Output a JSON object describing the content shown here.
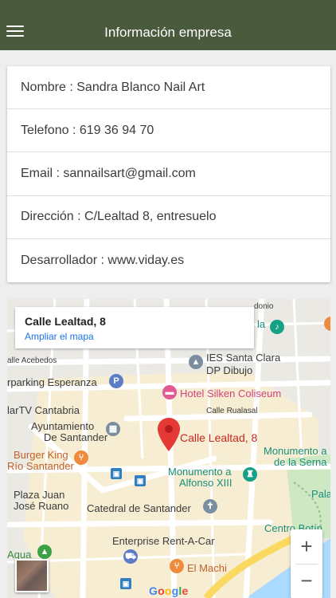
{
  "header": {
    "title": "Información empresa",
    "menu_icon": "hamburger-icon"
  },
  "company": {
    "rows": [
      {
        "label": "Nombre",
        "value": "Sandra Blanco Nail Art"
      },
      {
        "label": "Telefono",
        "value": "619 36 94 70"
      },
      {
        "label": "Email",
        "value": "sannailsart@gmail.com"
      },
      {
        "label": "Dirección",
        "value": "C/Lealtad 8, entresuelo"
      },
      {
        "label": "Desarrollador",
        "value": "www.viday.es"
      }
    ],
    "separator": " : "
  },
  "map": {
    "card_title": "Calle Lealtad, 8",
    "card_link": "Ampliar el mapa",
    "marker_label": "Calle Lealtad, 8",
    "zoom_in": "+",
    "zoom_out": "−",
    "google": [
      "G",
      "o",
      "o",
      "g",
      "l",
      "e"
    ],
    "google_colors": [
      "#4285F4",
      "#EA4335",
      "#FBBC05",
      "#4285F4",
      "#34A853",
      "#EA4335"
    ],
    "labels": {
      "donio": "donio",
      "la": "la",
      "acebedos": "alle Acebedos",
      "ies_santa_clara": "IES Santa Clara",
      "dp_dibujo": "DP Dibujo",
      "parking_esperanza": "rparking Esperanza",
      "hotel_silken": "Hotel Silken Coliseum",
      "lartv": "larTV Cantabria",
      "calle_rualasal": "Calle Rualasal",
      "ayuntamiento_1": "Ayuntamiento",
      "ayuntamiento_2": "De Santander",
      "burger_king": "Burger King",
      "rio_santander": "Río Santander",
      "monumento_serna_1": "Monumento a",
      "monumento_serna_2": "de la Serna",
      "monumento_alfonso_1": "Monumento a",
      "monumento_alfonso_2": "Alfonso XIII",
      "pala": "Pala",
      "plaza_juan_1": "Plaza Juan",
      "plaza_juan_2": "José Ruano",
      "catedral": "Catedral de Santander",
      "centro_botin": "Centro Botín",
      "enterprise": "Enterprise Rent-A-Car",
      "aqua": "Aqua",
      "el_machi": "El Machi"
    },
    "colors": {
      "header": "#4a5a3c",
      "marker": "#e53935",
      "link": "#1a73e8"
    }
  }
}
